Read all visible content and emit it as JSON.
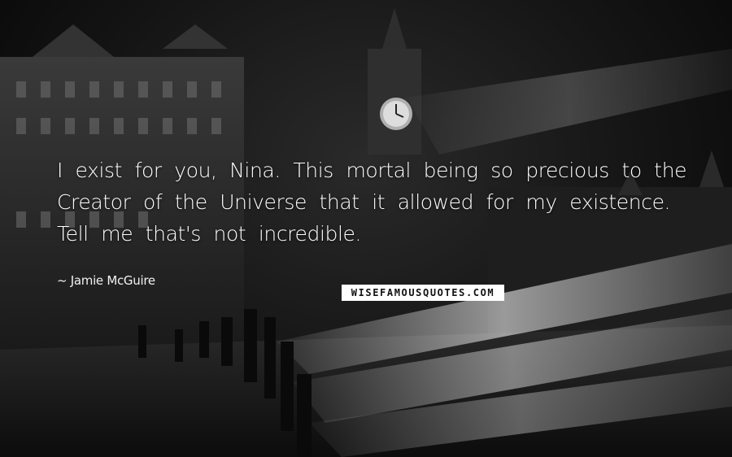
{
  "quote": {
    "text": "I exist for you, Nina. This mortal being so precious to the Creator of the Universe that it allowed for my existence. Tell me that's not incredible."
  },
  "author": {
    "label": "~ Jamie McGuire"
  },
  "watermark": {
    "text": "WISEFAMOUSQUOTES.COM"
  },
  "background": {
    "description_colors": {
      "sky": "#141414",
      "light_trails": "#d8d8d8"
    }
  }
}
